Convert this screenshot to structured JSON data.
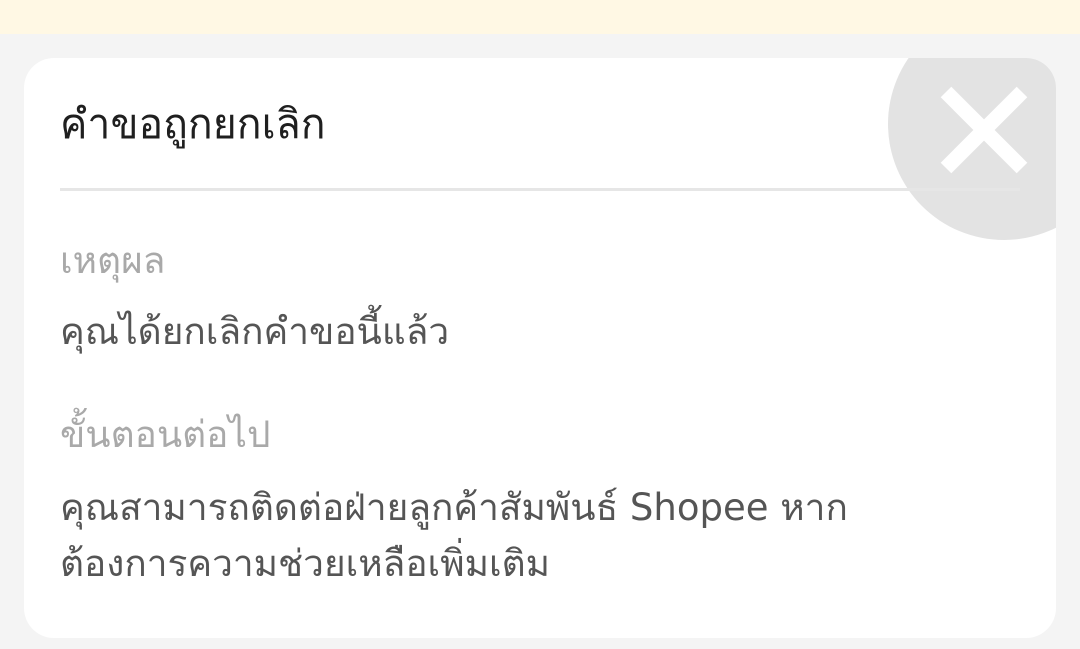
{
  "dialog": {
    "title": "คำขอถูกยกเลิก",
    "close_icon": "close-icon",
    "reason": {
      "label": "เหตุผล",
      "text": "คุณได้ยกเลิกคำขอนี้แล้ว"
    },
    "next_steps": {
      "label": "ขั้นตอนต่อไป",
      "text_line1": "คุณสามารถติดต่อฝ่ายลูกค้าสัมพันธ์ Shopee หาก",
      "text_line2": "ต้องการความช่วยเหลือเพิ่มเติม"
    }
  },
  "colors": {
    "banner": "#fff8e4",
    "background": "#f4f4f4",
    "card": "#ffffff",
    "close_circle": "#e3e3e3"
  }
}
